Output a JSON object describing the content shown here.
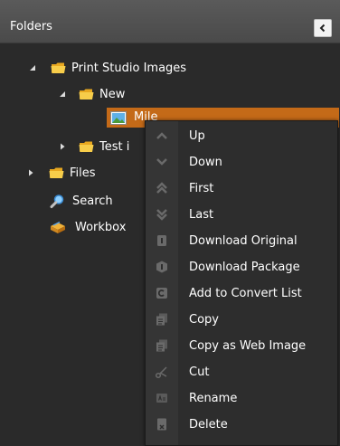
{
  "header": {
    "title": "Folders"
  },
  "tree": {
    "root": "Print Studio Images",
    "new_folder": "New",
    "selected_item": "Mile",
    "test_folder": "Test i",
    "files": "Files",
    "search": "Search",
    "workbox": "Workbox"
  },
  "context_menu": {
    "items": [
      {
        "label": "Up",
        "icon": "chevron-up-icon"
      },
      {
        "label": "Down",
        "icon": "chevron-down-icon"
      },
      {
        "label": "First",
        "icon": "double-chevron-up-icon"
      },
      {
        "label": "Last",
        "icon": "double-chevron-down-icon"
      },
      {
        "label": "Download Original",
        "icon": "download-original-icon"
      },
      {
        "label": "Download Package",
        "icon": "download-package-icon"
      },
      {
        "label": "Add to Convert List",
        "icon": "convert-icon"
      },
      {
        "label": "Copy",
        "icon": "copy-icon"
      },
      {
        "label": "Copy as Web Image",
        "icon": "copy-web-icon"
      },
      {
        "label": "Cut",
        "icon": "scissors-icon"
      },
      {
        "label": "Rename",
        "icon": "rename-icon"
      },
      {
        "label": "Delete",
        "icon": "delete-icon"
      }
    ]
  },
  "colors": {
    "header_bg": "#4f4f4f",
    "panel_bg": "#2a2a2a",
    "selection": "#c46a18",
    "folder": "#f4c23a",
    "menu_icon": "#6a6a6a"
  }
}
